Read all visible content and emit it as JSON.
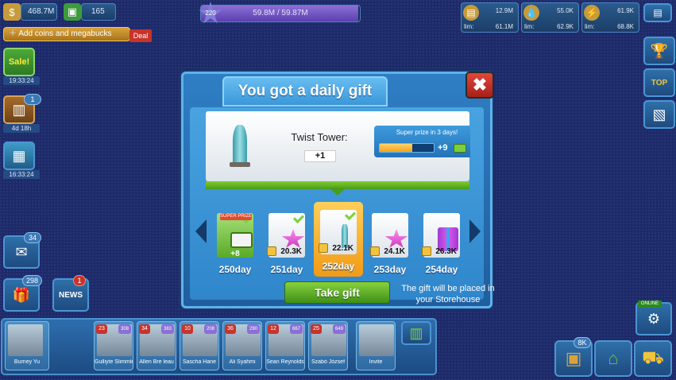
{
  "hud": {
    "coins": "468.7M",
    "megabucks": "165",
    "level": "220",
    "xp_text": "59.8M / 59.87M",
    "xp_progress": 0.99,
    "add_coins_label": "Add coins and megabucks",
    "deal_label": "Deal"
  },
  "resources": [
    {
      "icon": "materials-icon",
      "value": "12.9M",
      "lim_label": "lim:",
      "limit": "61.1M"
    },
    {
      "icon": "water-icon",
      "value": "55.0K",
      "lim_label": "lim:",
      "limit": "62.9K"
    },
    {
      "icon": "power-icon",
      "value": "61.9K",
      "lim_label": "lim:",
      "limit": "68.8K"
    }
  ],
  "left_panel": {
    "sale_label": "Sale!",
    "sale_timer": "19:33:24",
    "chest_badge": "1",
    "chest_timer": "4d 18h",
    "building_timer": "16:33:24",
    "mail_badge": "34",
    "gifts_badge": "298",
    "news_badge": "1",
    "news_label": "NEWS"
  },
  "right_panel": {
    "top_label": "TOP",
    "online_label": "ONLINE",
    "storage_badge": "8K"
  },
  "modal": {
    "title": "You got a daily gift",
    "close_label": "✖",
    "gift_name": "Twist Tower:",
    "gift_quantity": "+1",
    "super_prize_text": "Super prize in 3 days!",
    "super_progress": 0.6,
    "super_reward": "+9",
    "days": [
      {
        "label": "250day",
        "amount": "+8",
        "tag": "SUPER PRIZE",
        "kind": "cash",
        "claimed": true
      },
      {
        "label": "251day",
        "amount": "20.3K",
        "kind": "gem",
        "claimed": true
      },
      {
        "label": "252day",
        "amount": "22.1K",
        "kind": "tower",
        "claimed": true,
        "current": true
      },
      {
        "label": "253day",
        "amount": "24.1K",
        "kind": "gem",
        "claimed": false
      },
      {
        "label": "254day",
        "amount": "26.3K",
        "kind": "gift",
        "claimed": false
      }
    ],
    "take_button": "Take gift",
    "note": "The gift will be placed in your Storehouse"
  },
  "friends": [
    {
      "name": "Burney Yu",
      "level": "",
      "xp": ""
    },
    {
      "name": "Gulliyte Slimmler",
      "level": "23",
      "xp": "308"
    },
    {
      "name": "Allen Bre leau",
      "level": "34",
      "xp": "383"
    },
    {
      "name": "Sascha Hane",
      "level": "10",
      "xp": "208"
    },
    {
      "name": "Ali Syahmi",
      "level": "36",
      "xp": "290"
    },
    {
      "name": "Sean Reynolds",
      "level": "12",
      "xp": "667"
    },
    {
      "name": "Szabó József",
      "level": "25",
      "xp": "649"
    },
    {
      "name": "Invite",
      "level": "",
      "xp": ""
    }
  ]
}
